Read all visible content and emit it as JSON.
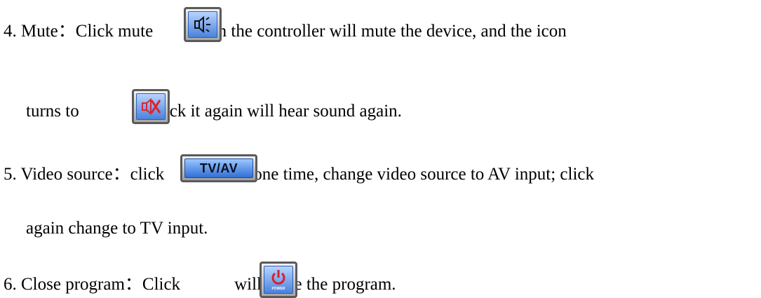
{
  "items": [
    {
      "lead": "4. Mute：Click mute",
      "after_icon": "on the controller will mute the device, and the icon",
      "cont_before": "turns to",
      "cont_after": ". Click it again will hear sound again."
    },
    {
      "lead": "5. Video source：click",
      "after_icon": "one time, change video source to AV input; click",
      "cont": "again change to TV input."
    },
    {
      "lead": "6. Close program：Click",
      "after_icon": "will close the program."
    }
  ],
  "buttons": {
    "mute_icon": "speaker-icon",
    "muted_icon": "speaker-muted-icon",
    "tvav_label": "TV/AV",
    "power_icon": "power-icon",
    "power_label": "POWER"
  },
  "colors": {
    "button_blue": "#4a82dc",
    "mute_red": "#e0242c",
    "power_red": "#d8202a"
  }
}
